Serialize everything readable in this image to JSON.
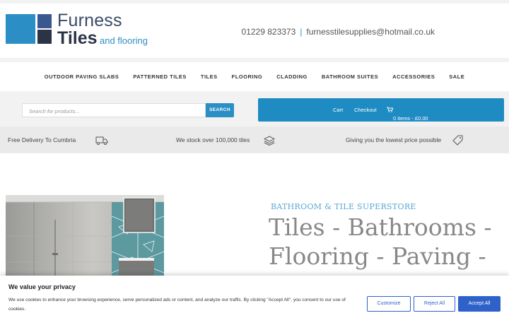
{
  "logo": {
    "word1": "Furness",
    "word2": "Tiles",
    "word3": "and flooring"
  },
  "contact": {
    "phone": "01229 823373",
    "separator": "|",
    "email": "furnesstilesupplies@hotmail.co.uk"
  },
  "nav": {
    "items": [
      {
        "label": "OUTDOOR PAVING SLABS"
      },
      {
        "label": "PATTERNED TILES"
      },
      {
        "label": "TILES"
      },
      {
        "label": "FLOORING"
      },
      {
        "label": "CLADDING"
      },
      {
        "label": "BATHROOM SUITES"
      },
      {
        "label": "ACCESSORIES"
      },
      {
        "label": "SALE"
      }
    ]
  },
  "search": {
    "placeholder": "Search for products...",
    "button": "SEARCH"
  },
  "cart": {
    "cart_label": "Cart",
    "checkout_label": "Checkout",
    "summary": "0 items - £0.00",
    "cart_icon": "shopping-cart-icon"
  },
  "features": {
    "delivery": "Free Delivery To Cumbria",
    "stock": "We stock over 100,000 tiles",
    "price": "Giving you the lowest price possible",
    "icons": [
      "truck-icon",
      "layers-icon",
      "tag-icon"
    ]
  },
  "hero": {
    "subtitle": "BATHROOM & TILE SUPERSTORE",
    "heading": "Tiles - Bathrooms - Flooring - Paving -"
  },
  "cookie": {
    "title": "We value your privacy",
    "body": "We use cookies to enhance your browsing experience, serve personalized ads or content, and analyze our traffic. By clicking \"Accept All\", you consent to our use of cookies.",
    "customize": "Customize",
    "reject": "Reject All",
    "accept": "Accept All"
  },
  "colors": {
    "brand_blue": "#2b8fc6",
    "navy": "#2b3446",
    "cookie_button": "#2f62c9"
  }
}
